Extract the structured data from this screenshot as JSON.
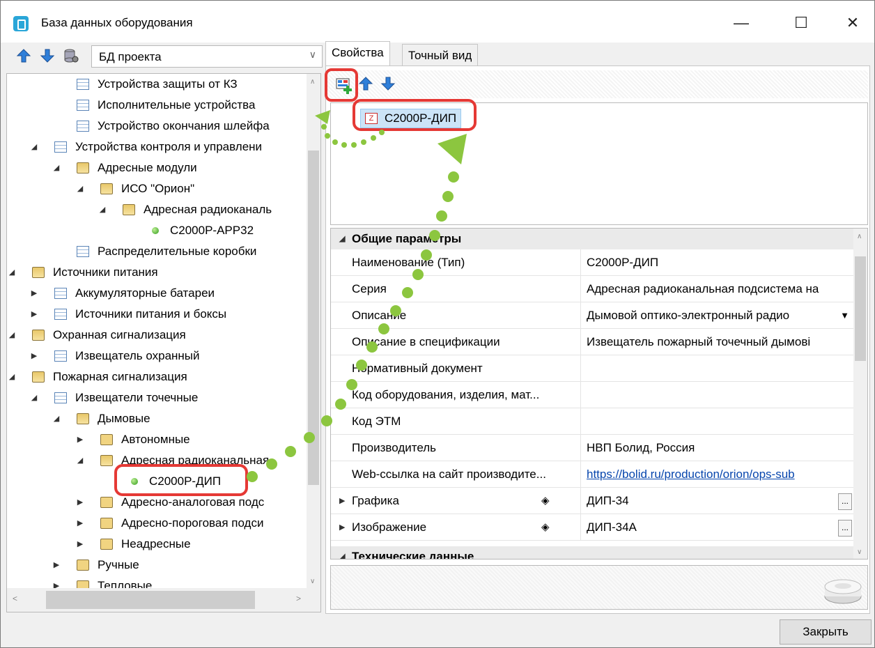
{
  "window": {
    "title": "База данных оборудования",
    "minimize": "—",
    "maximize": "☐",
    "close": "✕"
  },
  "left_toolbar": {
    "db_selector": "БД проекта"
  },
  "tree": [
    {
      "label": "Устройства защиты от КЗ",
      "icon": "table-icon",
      "expander": ""
    },
    {
      "label": "Исполнительные устройства",
      "icon": "table-icon",
      "expander": ""
    },
    {
      "label": "Устройство окончания шлейфа",
      "icon": "table-icon",
      "expander": ""
    },
    {
      "label": "Устройства контроля и управлени",
      "icon": "table-icon",
      "expander": "◢"
    },
    {
      "label": "Адресные модули",
      "icon": "folder-open-icon",
      "expander": "◢"
    },
    {
      "label": "ИСО \"Орион\"",
      "icon": "folder-open-icon",
      "expander": "◢"
    },
    {
      "label": "Адресная радиоканаль",
      "icon": "folder-open-icon",
      "expander": "◢"
    },
    {
      "label": "С2000Р-АРР32",
      "icon": "device-dot-icon",
      "expander": ""
    },
    {
      "label": "Распределительные коробки",
      "icon": "table-icon",
      "expander": ""
    },
    {
      "label": "Источники питания",
      "icon": "folder-open-icon",
      "expander": "◢"
    },
    {
      "label": "Аккумуляторные батареи",
      "icon": "table-icon",
      "expander": "▶"
    },
    {
      "label": "Источники питания и боксы",
      "icon": "table-icon",
      "expander": "▶"
    },
    {
      "label": "Охранная сигнализация",
      "icon": "folder-open-icon",
      "expander": "◢"
    },
    {
      "label": "Извещатель охранный",
      "icon": "table-icon",
      "expander": "▶"
    },
    {
      "label": "Пожарная сигнализация",
      "icon": "folder-open-icon",
      "expander": "◢"
    },
    {
      "label": "Извещатели точечные",
      "icon": "table-icon",
      "expander": "◢"
    },
    {
      "label": "Дымовые",
      "icon": "folder-open-icon",
      "expander": "◢"
    },
    {
      "label": "Автономные",
      "icon": "folder-icon",
      "expander": "▶"
    },
    {
      "label": "Адресная радиоканальная",
      "icon": "folder-open-icon",
      "expander": "◢"
    },
    {
      "label": "С2000Р-ДИП",
      "icon": "device-dot-icon",
      "expander": ""
    },
    {
      "label": "Адресно-аналоговая подс",
      "icon": "folder-icon",
      "expander": "▶"
    },
    {
      "label": "Адресно-пороговая подси",
      "icon": "folder-icon",
      "expander": "▶"
    },
    {
      "label": "Неадресные",
      "icon": "folder-icon",
      "expander": "▶"
    },
    {
      "label": "Ручные",
      "icon": "folder-icon",
      "expander": "▶"
    },
    {
      "label": "Тепловые",
      "icon": "folder-icon",
      "expander": "▶"
    }
  ],
  "tabs": [
    {
      "label": "Свойства"
    },
    {
      "label": "Точный вид"
    }
  ],
  "list_item": {
    "label": "С2000Р-ДИП",
    "icon_letter": "Z"
  },
  "properties": {
    "section_general": "Общие параметры",
    "rows": [
      {
        "key": "Наименование (Тип)",
        "value": "С2000Р-ДИП"
      },
      {
        "key": "Серия",
        "value": "Адресная радиоканальная подсистема на"
      },
      {
        "key": "Описание",
        "value": "Дымовой оптико-электронный радио"
      },
      {
        "key": "Описание в спецификации",
        "value": "Извещатель пожарный точечный дымові"
      },
      {
        "key": "Нормативный документ",
        "value": ""
      },
      {
        "key": "Код оборудования, изделия, мат...",
        "value": ""
      },
      {
        "key": "Код ЭТМ",
        "value": ""
      },
      {
        "key": "Производитель",
        "value": "НВП Болид, Россия"
      },
      {
        "key": "Web-ссылка на сайт производите...",
        "value": "https://bolid.ru/production/orion/ops-sub"
      },
      {
        "key": "Графика",
        "value": "ДИП-34"
      },
      {
        "key": "Изображение",
        "value": "ДИП-34А"
      }
    ],
    "section_tech": "Технические данные",
    "dropdown_arrow": "▼",
    "ellipsis": "...",
    "diamond": "◈"
  },
  "footer": {
    "close_label": "Закрыть"
  },
  "colors": {
    "highlight": "#e53935",
    "path": "#8cc63f",
    "selection": "#cce4f7"
  }
}
